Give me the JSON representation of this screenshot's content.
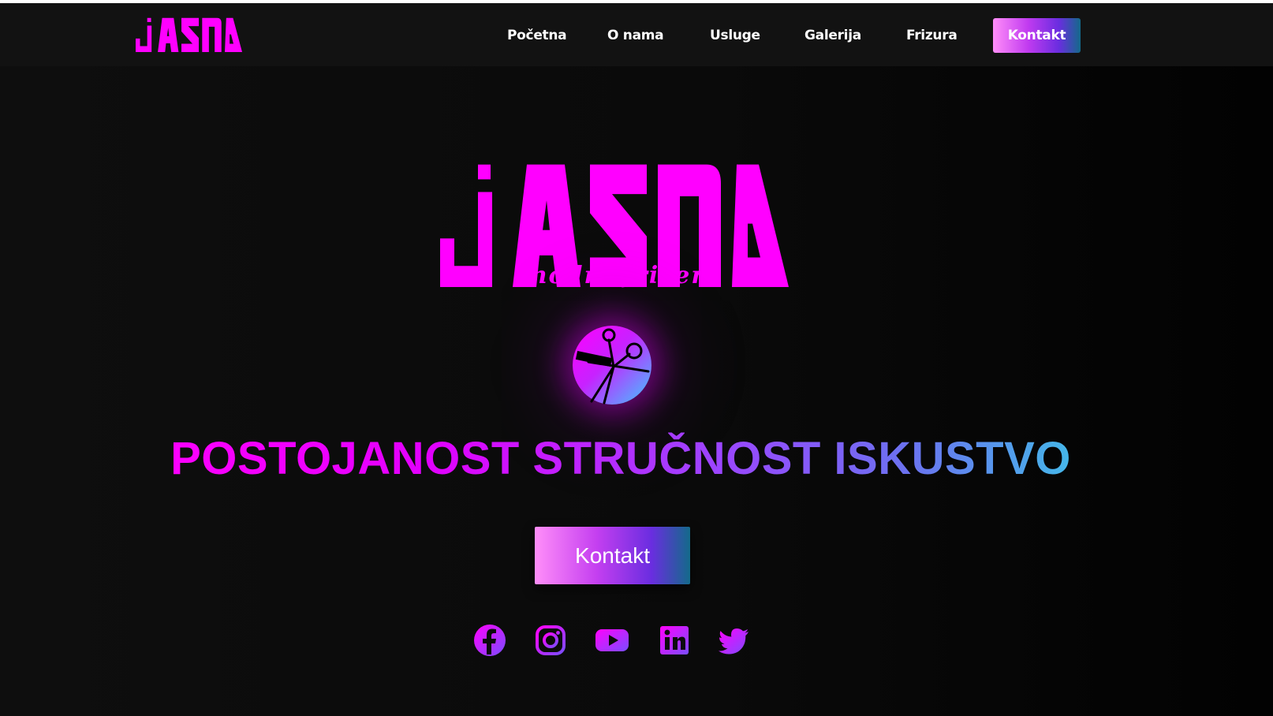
{
  "brand": {
    "logo_text": "jASNA",
    "subtitle": "modni frizer",
    "accent_color": "#ff00ff"
  },
  "nav": {
    "items": [
      {
        "label": "Početna"
      },
      {
        "label": "O nama"
      },
      {
        "label": "Usluge"
      },
      {
        "label": "Galerija"
      },
      {
        "label": "Frizura"
      }
    ],
    "cta_label": "Kontakt"
  },
  "hero": {
    "icon": "scissors-comb-icon",
    "tagline": "POSTOJANOST STRUČNOST ISKUSTVO",
    "cta_label": "Kontakt",
    "gradient": [
      "#ff00ff",
      "#9c45ff",
      "#3ec3e8"
    ]
  },
  "social": [
    {
      "icon": "facebook-icon"
    },
    {
      "icon": "instagram-icon"
    },
    {
      "icon": "youtube-icon"
    },
    {
      "icon": "linkedin-icon"
    },
    {
      "icon": "twitter-icon"
    }
  ]
}
